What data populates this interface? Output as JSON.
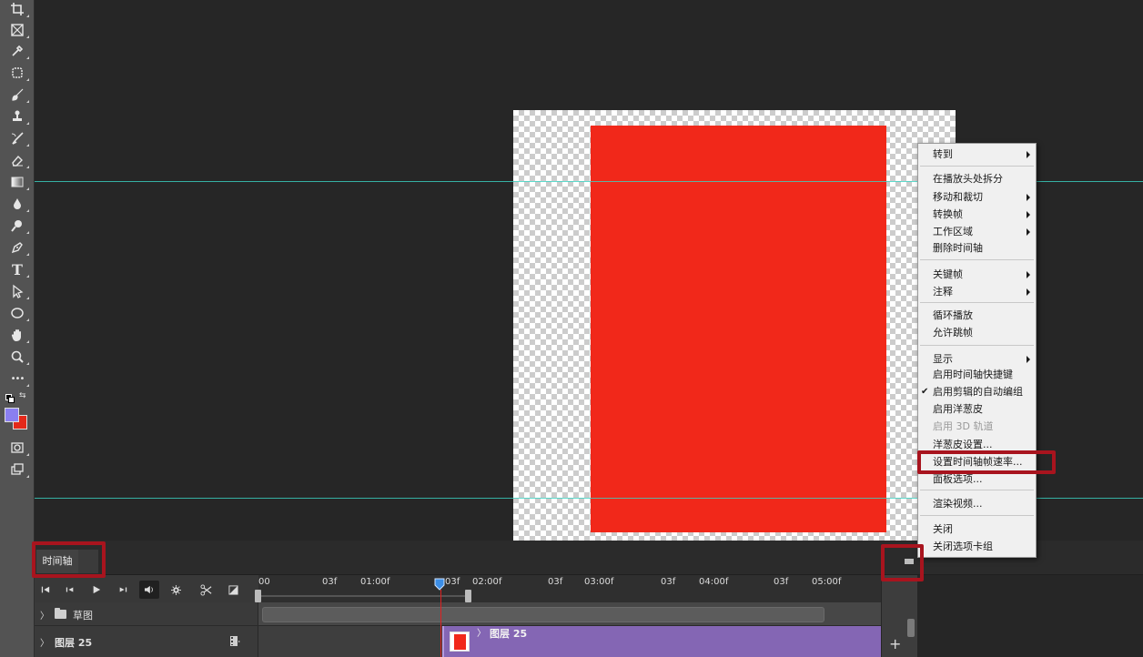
{
  "toolbar": {
    "tools": [
      {
        "name": "crop-tool-icon"
      },
      {
        "name": "frame-tool-icon"
      },
      {
        "name": "eyedropper-tool-icon"
      },
      {
        "name": "spot-healing-tool-icon"
      },
      {
        "name": "brush-tool-icon"
      },
      {
        "name": "clone-stamp-tool-icon"
      },
      {
        "name": "history-brush-tool-icon"
      },
      {
        "name": "eraser-tool-icon"
      },
      {
        "name": "gradient-tool-icon"
      },
      {
        "name": "blur-tool-icon"
      },
      {
        "name": "dodge-tool-icon"
      },
      {
        "name": "pen-tool-icon"
      },
      {
        "name": "type-tool-icon",
        "glyph": "T"
      },
      {
        "name": "path-selection-tool-icon"
      },
      {
        "name": "ellipse-tool-icon"
      },
      {
        "name": "hand-tool-icon"
      },
      {
        "name": "zoom-tool-icon"
      },
      {
        "name": "more-tools-icon",
        "glyph": "•••"
      }
    ],
    "foreground_color": "#8a7ff0",
    "background_color": "#e4291a"
  },
  "canvas": {
    "layer_fill_color": "#f1281a",
    "guide_color": "#3ad3c3"
  },
  "context_menu": {
    "items": [
      {
        "label": "转到",
        "submenu": true
      },
      {
        "sep": true
      },
      {
        "label": "在播放头处拆分"
      },
      {
        "label": "移动和裁切",
        "submenu": true
      },
      {
        "label": "转换帧",
        "submenu": true
      },
      {
        "label": "工作区域",
        "submenu": true
      },
      {
        "label": "删除时间轴"
      },
      {
        "sep": true
      },
      {
        "label": "关键帧",
        "submenu": true
      },
      {
        "label": "注释",
        "submenu": true
      },
      {
        "sep": true
      },
      {
        "label": "循环播放"
      },
      {
        "label": "允许跳帧"
      },
      {
        "sep": true
      },
      {
        "label": "显示",
        "submenu": true
      },
      {
        "label": "启用时间轴快捷键"
      },
      {
        "label": "启用剪辑的自动编组",
        "checked": true
      },
      {
        "label": "启用洋葱皮"
      },
      {
        "label": "启用 3D 轨道",
        "disabled": true
      },
      {
        "label": "洋葱皮设置..."
      },
      {
        "label": "设置时间轴帧速率..."
      },
      {
        "label": "面板选项..."
      },
      {
        "sep": true
      },
      {
        "label": "渲染视频..."
      },
      {
        "sep": true
      },
      {
        "label": "关闭"
      },
      {
        "label": "关闭选项卡组"
      }
    ]
  },
  "timeline": {
    "tab_label": "时间轴",
    "ruler_ticks": [
      "00",
      "03f",
      "01:00f",
      "03f",
      "02:00f",
      "03f",
      "03:00f",
      "03f",
      "04:00f",
      "03f",
      "05:00f"
    ],
    "playhead_label": "03f",
    "tracks": {
      "sketch_label": "草图",
      "layer_label": "图层 25",
      "clip_label": "图层 25"
    },
    "clip_color": "#8466b4"
  }
}
